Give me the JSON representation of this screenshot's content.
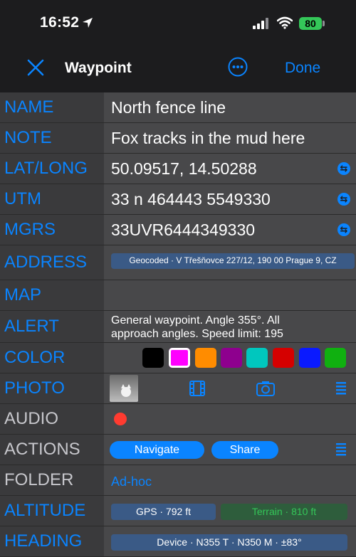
{
  "status": {
    "time": "16:52",
    "battery": "80"
  },
  "nav": {
    "title": "Waypoint",
    "done": "Done"
  },
  "rows": {
    "name": {
      "label": "NAME",
      "value": "North fence line"
    },
    "note": {
      "label": "NOTE",
      "value": "Fox tracks in the mud here"
    },
    "latlong": {
      "label": "LAT/LONG",
      "value": "50.09517, 14.50288"
    },
    "utm": {
      "label": "UTM",
      "value": "33 n 464443 5549330"
    },
    "mgrs": {
      "label": "MGRS",
      "value": "33UVR6444349330"
    },
    "address": {
      "label": "ADDRESS",
      "value": "Geocoded · V Třešňovce 227/12, 190 00 Prague 9, CZ"
    },
    "map": {
      "label": "MAP"
    },
    "alert": {
      "label": "ALERT",
      "value": "General waypoint. Angle 355°.  All approach angles. Speed limit: 195"
    },
    "color": {
      "label": "COLOR",
      "swatches": [
        "#000000",
        "#ff00ff",
        "#ff8c00",
        "#8e008e",
        "#00c7be",
        "#d50000",
        "#0a1aff",
        "#10b010"
      ]
    },
    "photo": {
      "label": "PHOTO"
    },
    "audio": {
      "label": "AUDIO"
    },
    "actions": {
      "label": "ACTIONS",
      "navigate": "Navigate",
      "share": "Share"
    },
    "folder": {
      "label": "FOLDER",
      "value": "Ad-hoc"
    },
    "altitude": {
      "label": "ALTITUDE",
      "gps": "GPS · 792 ft",
      "terrain": "Terrain · 810 ft"
    },
    "heading": {
      "label": "HEADING",
      "value": "Device · N355 T · N350 M · ±83°"
    }
  },
  "colors": {
    "accent": "#0a84ff",
    "label_bg": "#3a3a3c",
    "value_bg": "#48484a"
  }
}
